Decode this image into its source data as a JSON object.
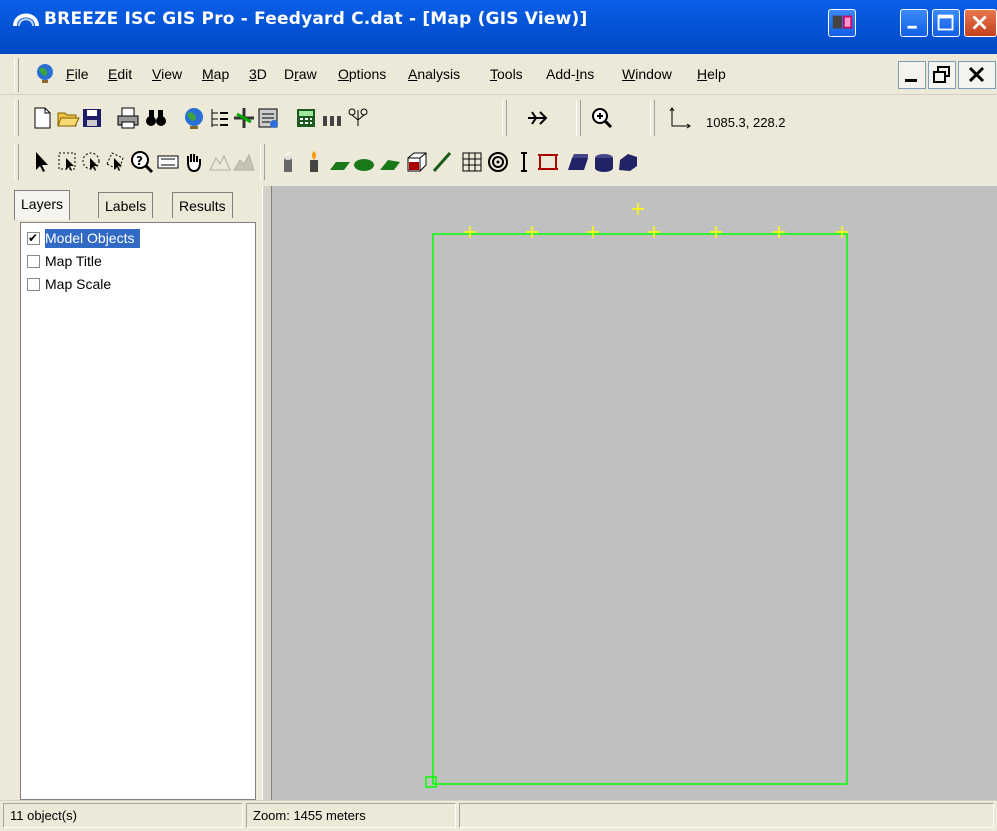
{
  "window": {
    "title": "BREEZE ISC GIS Pro - Feedyard C.dat - [Map (GIS View)]"
  },
  "menu": {
    "items": [
      {
        "label": "File",
        "accel": "F"
      },
      {
        "label": "Edit",
        "accel": "E"
      },
      {
        "label": "View",
        "accel": "V"
      },
      {
        "label": "Map",
        "accel": "M"
      },
      {
        "label": "3D",
        "accel": "3"
      },
      {
        "label": "Draw",
        "accel": "r"
      },
      {
        "label": "Options",
        "accel": "O"
      },
      {
        "label": "Analysis",
        "accel": "A"
      },
      {
        "label": "Tools",
        "accel": "T"
      },
      {
        "label": "Add-Ins",
        "accel": "I"
      },
      {
        "label": "Window",
        "accel": "W"
      },
      {
        "label": "Help",
        "accel": "H"
      }
    ]
  },
  "toolbar": {
    "coordinates": "1085.3, 228.2"
  },
  "tabs": [
    {
      "label": "Layers"
    },
    {
      "label": "Labels"
    },
    {
      "label": "Results"
    }
  ],
  "layers": [
    {
      "label": "Model Objects",
      "checked": true
    },
    {
      "label": "Map Title",
      "checked": false
    },
    {
      "label": "Map Scale",
      "checked": false
    }
  ],
  "status": {
    "objects": "11 object(s)",
    "zoom": "Zoom: 1455 meters"
  },
  "colors": {
    "titlebar": "#0454d6",
    "map_background": "#c0c0c0",
    "boundary": "#00ff00",
    "receptor": "#ffff00",
    "selection": "#316ac5"
  }
}
